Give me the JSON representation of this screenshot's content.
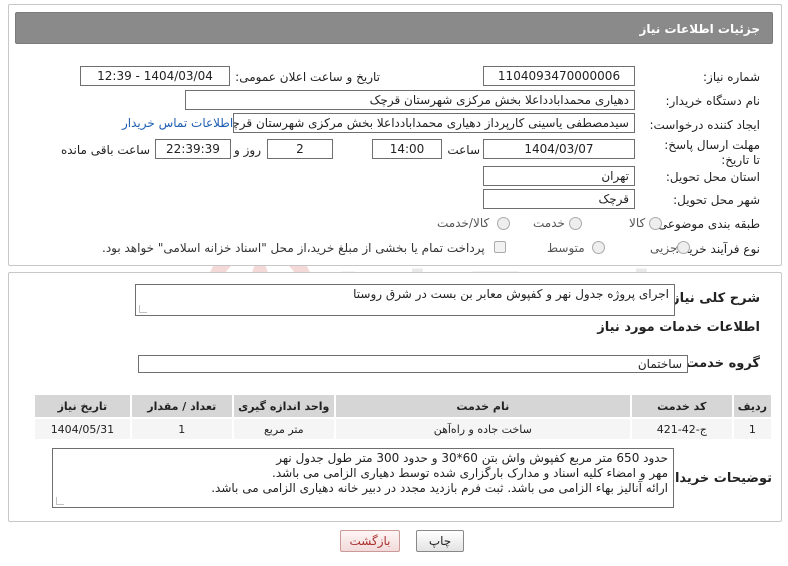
{
  "header": {
    "title": "جزئیات اطلاعات نیاز"
  },
  "labels": {
    "need_number": "شماره نیاز:",
    "announce_datetime": "تاریخ و ساعت اعلان عمومی:",
    "buyer_org": "نام دستگاه خریدار:",
    "requester": "ایجاد کننده درخواست:",
    "deadline": "مهلت ارسال پاسخ: تا تاریخ:",
    "time": "ساعت",
    "day_and": "روز و",
    "remaining": "ساعت باقی مانده",
    "province": "استان محل تحویل:",
    "city": "شهر محل تحویل:",
    "category": "طبقه بندی موضوعی:",
    "process_type": "نوع فرآیند خرید :",
    "general_desc": "شرح کلی نیاز:",
    "services_info": "اطلاعات خدمات مورد نیاز",
    "service_group": "گروه خدمت:",
    "buyer_notes": "توضیحات خریدار:"
  },
  "values": {
    "need_number": "1104093470000006",
    "announce_datetime": "1404/03/04 - 12:39",
    "buyer_org": "دهیاری محمدابادداعلا بخش مرکزی شهرستان قرچک",
    "requester": "سیدمصطفی یاسینی کارپرداز دهیاری محمدابادداعلا بخش مرکزی شهرستان قرچک",
    "contact_link": "اطلاعات تماس خریدار",
    "deadline_date": "1404/03/07",
    "deadline_time": "14:00",
    "days": "2",
    "remaining_time": "22:39:39",
    "province": "تهران",
    "city": "قرچک",
    "general_desc": "اجرای پروژه جدول نهر و کفپوش معابر بن بست در شرق روستا",
    "service_group": "ساختمان"
  },
  "category_options": [
    "کالا",
    "خدمت",
    "کالا/خدمت"
  ],
  "process_options": [
    "جزیی",
    "متوسط"
  ],
  "process_note": "پرداخت تمام یا بخشی از مبلغ خرید،از محل \"اسناد خزانه اسلامی\" خواهد بود.",
  "table": {
    "headers": [
      "ردیف",
      "کد خدمت",
      "نام خدمت",
      "واحد اندازه گیری",
      "تعداد / مقدار",
      "تاریخ نیاز"
    ],
    "rows": [
      [
        "1",
        "ج-42-421",
        "ساخت جاده و راه‌آهن",
        "متر مربع",
        "1",
        "1404/05/31"
      ]
    ]
  },
  "buyer_notes": [
    "حدود 650 متر مربع کفپوش واش بتن 60*30 و حدود 300 متر طول جدول نهر",
    "مهر و امضاء کلیه اسناد و مدارک بارگزاری شده توسط دهیاری الزامی می باشد.",
    "ارائه آنالیز بهاء الزامی می باشد. ثبت فرم بازدید مجدد در دبیر خانه دهیاری الزامی می باشد."
  ],
  "buttons": {
    "print": "چاپ",
    "back": "بازگشت"
  },
  "watermark": {
    "text": "AriaTender.neT"
  },
  "colors": {
    "header_bg": "#8a8a8a",
    "link": "#1f5fb3",
    "watermark": "#c0392b"
  }
}
